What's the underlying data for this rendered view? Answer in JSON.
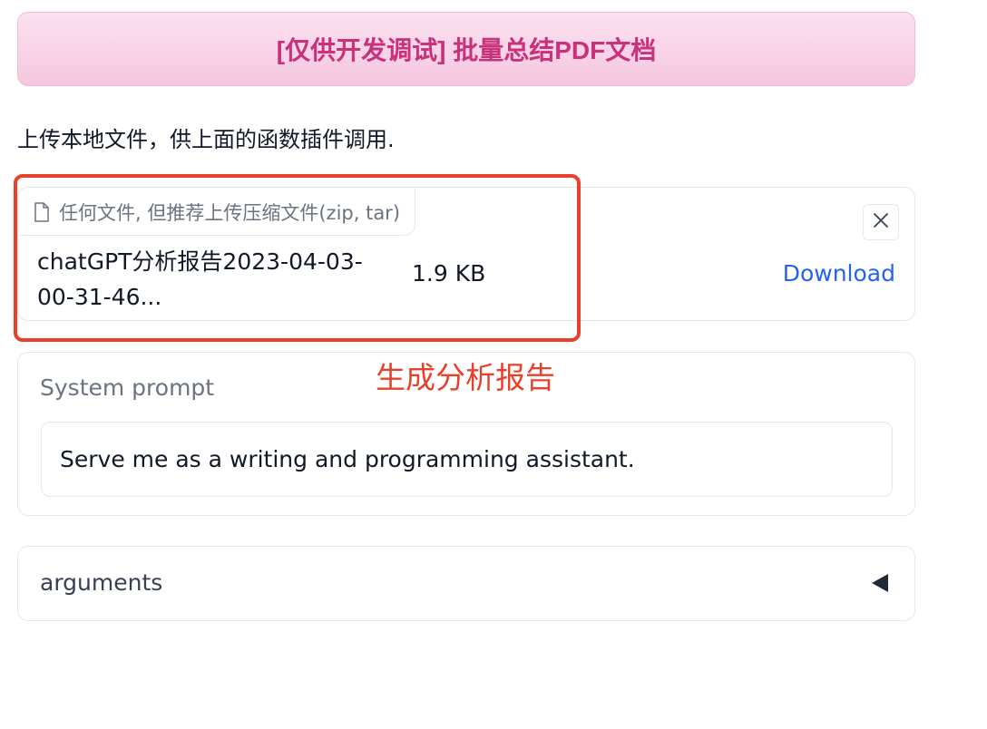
{
  "header": {
    "batch_pdf_button_label": "[仅供开发调试] 批量总结PDF文档"
  },
  "upload": {
    "description": "上传本地文件，供上面的函数插件调用.",
    "file_label": "任何文件, 但推荐上传压缩文件(zip, tar)",
    "file_icon": "file-icon",
    "close_icon": "close-icon",
    "file_name": "chatGPT分析报告2023-04-03-00-31-46...",
    "file_size": "1.9 KB",
    "download_label": "Download"
  },
  "annotation": {
    "text": "生成分析报告",
    "color": "#e8402a"
  },
  "system_prompt": {
    "label": "System prompt",
    "value": "Serve me as a writing and programming assistant."
  },
  "arguments": {
    "label": "arguments",
    "toggle_icon": "triangle-left-icon"
  },
  "colors": {
    "accent_pink": "#c8317c",
    "link_blue": "#2563eb",
    "annotation_red": "#e8402a"
  }
}
